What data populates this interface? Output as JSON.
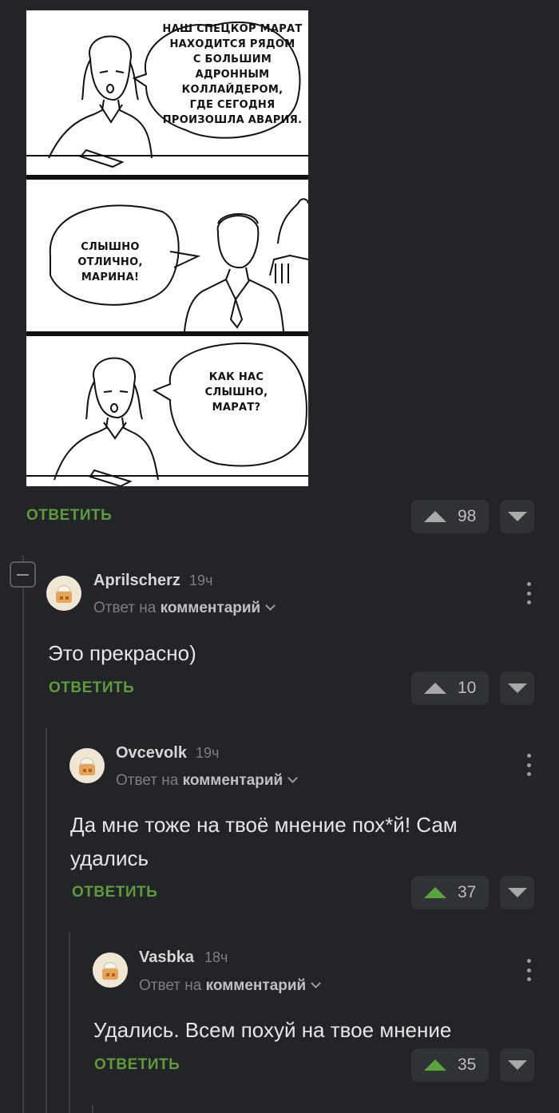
{
  "comic": {
    "panel1_text": [
      "НАШ СПЕЦКОР МАРАТ",
      "НАХОДИТСЯ РЯДОМ",
      "С БОЛЬШИМ АДРОННЫМ",
      "КОЛЛАЙДЕРОМ,",
      "ГДЕ СЕГОДНЯ",
      "ПРОИЗОШЛА АВАРИЯ."
    ],
    "panel2_text": [
      "СЛЫШНО",
      "ОТЛИЧНО,",
      "МАРИНА!"
    ],
    "panel3_text": [
      "КАК НАС СЛЫШНО,",
      "МАРАТ?"
    ]
  },
  "post": {
    "reply_label": "ОТВЕТИТЬ",
    "votes": "98"
  },
  "comments": [
    {
      "username": "Aprilscherz",
      "time": "19ч",
      "reply_prefix": "Ответ на",
      "reply_target": "комментарий",
      "text": "Это прекрасно)",
      "reply_label": "ОТВЕТИТЬ",
      "votes": "10",
      "upvoted": false
    },
    {
      "username": "Ovcevolk",
      "time": "19ч",
      "reply_prefix": "Ответ на",
      "reply_target": "комментарий",
      "text": "Да мне тоже на твоё мнение пох*й! Сам удались",
      "reply_label": "ОТВЕТИТЬ",
      "votes": "37",
      "upvoted": true
    },
    {
      "username": "Vasbka",
      "time": "18ч",
      "reply_prefix": "Ответ на",
      "reply_target": "комментарий",
      "text": "Удались. Всем похуй на твое мнение",
      "reply_label": "ОТВЕТИТЬ",
      "votes": "35",
      "upvoted": true
    }
  ],
  "colors": {
    "background": "#222427",
    "reply_green": "#5f9a3c",
    "upvote_green": "#5aa33a"
  }
}
